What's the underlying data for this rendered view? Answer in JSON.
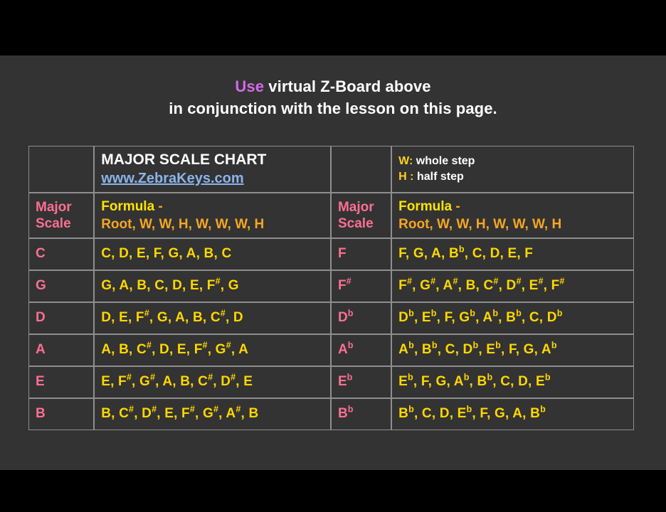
{
  "intro": {
    "emphasis_word": "Use",
    "line1_rest": " virtual Z-Board above",
    "line2": "in conjunction with the lesson on this page."
  },
  "table": {
    "title": "MAJOR SCALE CHART",
    "website": "www.ZebraKeys.com",
    "legend": {
      "whole_key": "W:",
      "whole_text": " whole step",
      "half_key": "H :",
      "half_text": " half step"
    },
    "headers": {
      "scale_line1": "Major",
      "scale_line2": "Scale",
      "formula_word": "Formula",
      "formula_dash": " -",
      "formula_pattern": "Root, W, W, H, W, W, W, H"
    },
    "left_rows": [
      {
        "scale": "C",
        "scale_accidental": "",
        "notes": "C, D, E, F, G, A, B, C"
      },
      {
        "scale": "G",
        "scale_accidental": "",
        "notes": "G, A, B, C, D, E, F#, G"
      },
      {
        "scale": "D",
        "scale_accidental": "",
        "notes": "D, E, F#, G, A, B, C#, D"
      },
      {
        "scale": "A",
        "scale_accidental": "",
        "notes": "A, B, C#, D, E, F#, G#, A"
      },
      {
        "scale": "E",
        "scale_accidental": "",
        "notes": "E, F#, G#, A, B, C#, D#, E"
      },
      {
        "scale": "B",
        "scale_accidental": "",
        "notes": "B, C#, D#, E, F#, G#, A#, B"
      }
    ],
    "right_rows": [
      {
        "scale": "F",
        "scale_accidental": "",
        "notes": "F, G, A, Bb, C, D, E, F"
      },
      {
        "scale": "F",
        "scale_accidental": "#",
        "notes": "F#, G#, A#, B, C#, D#, E#, F#"
      },
      {
        "scale": "D",
        "scale_accidental": "b",
        "notes": "Db, Eb, F, Gb, Ab, Bb, C, Db"
      },
      {
        "scale": "A",
        "scale_accidental": "b",
        "notes": "Ab, Bb, C, Db, Eb, F, G, Ab"
      },
      {
        "scale": "E",
        "scale_accidental": "b",
        "notes": "Eb, F, G, Ab, Bb, C, D, Eb"
      },
      {
        "scale": "B",
        "scale_accidental": "b",
        "notes": "Bb, C, D, Eb, F, G, A, Bb"
      }
    ]
  },
  "colors": {
    "background": "#333333",
    "letterbox": "#000000",
    "border": "#8e8e8e",
    "scale_pink": "#fb6f92",
    "notes_yellow": "#ffd700",
    "formula_orange": "#f5a623",
    "formula_yellow": "#ffe400",
    "link_blue": "#8ab4e8",
    "title_white": "#ffffff",
    "emphasis_violet": "#d26ae8"
  }
}
